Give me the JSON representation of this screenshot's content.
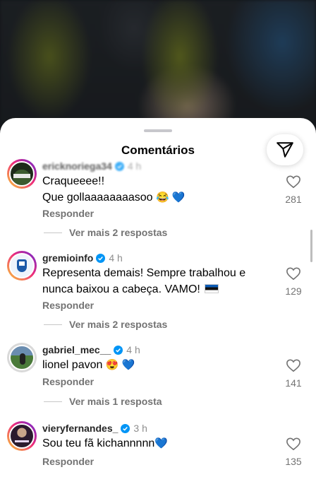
{
  "sheet": {
    "title": "Comentários",
    "share_icon": "send-icon"
  },
  "comments": [
    {
      "username": "ericknoriega34",
      "time": "4 h",
      "verified": true,
      "line1": "Craqueeee!!",
      "line2": "Que gollaaaaaaaasoo",
      "emojis": "😂 💙",
      "reply": "Responder",
      "view_replies": "Ver mais 2 respostas",
      "likes": "281"
    },
    {
      "username": "gremioinfo",
      "time": "4 h",
      "verified": true,
      "line1": "Representa demais! Sempre trabalhou e",
      "line2": "nunca baixou a cabeça. VAMO!",
      "reply": "Responder",
      "view_replies": "Ver mais 2 respostas",
      "likes": "129"
    },
    {
      "username": "gabriel_mec__",
      "time": "4 h",
      "verified": true,
      "line1": "lionel pavon",
      "emojis": "😍 💙",
      "reply": "Responder",
      "view_replies": "Ver mais 1 resposta",
      "likes": "141"
    },
    {
      "username": "vieryfernandes_",
      "time": "3 h",
      "verified": true,
      "line1": "Sou teu fã kichannnnn",
      "emojis": "💙",
      "reply": "Responder",
      "likes": "135"
    }
  ]
}
